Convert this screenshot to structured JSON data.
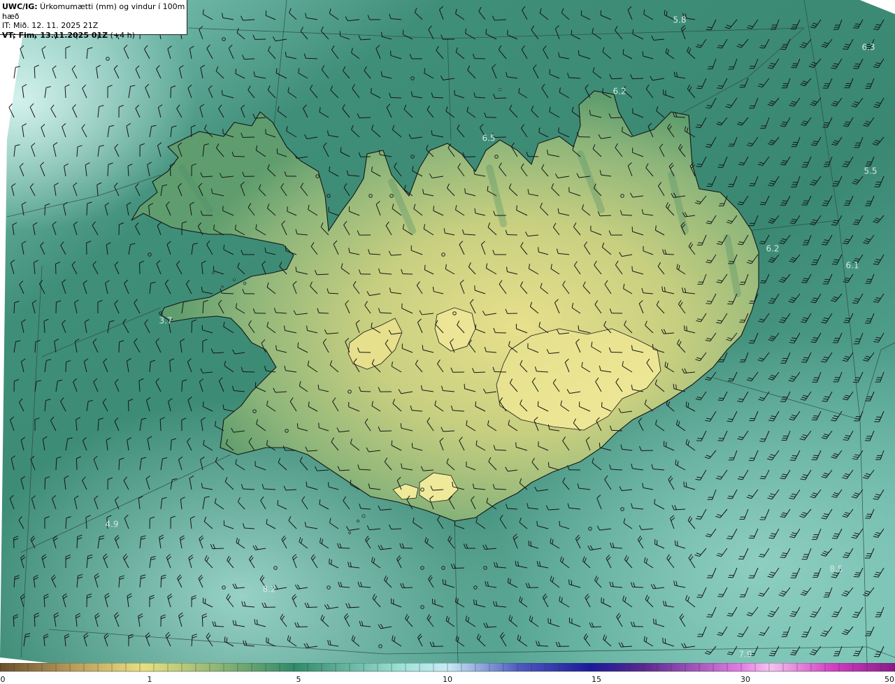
{
  "header": {
    "line1_bold": "UWC/IG:",
    "line1_rest": " Úrkomumætti (mm) og vindur í 100m hæð",
    "line2": "IT: Mið. 12. 11. 2025 21Z",
    "line3_bold": "VT: Fim. 13.11.2025 01Z",
    "line3_rest": " (+4 h)"
  },
  "map": {
    "region": "Iceland",
    "field": "precipitable water",
    "wind_symbol": "wind-barb-icon",
    "sea_color": "#3e8c76",
    "land_low_color": "#5a9a6e",
    "land_high_color": "#e6e08a",
    "coast_color": "#1a1a1a",
    "value_labels": [
      {
        "text": "5.8"
      },
      {
        "text": "6.3"
      },
      {
        "text": "6.2"
      },
      {
        "text": "6.5"
      },
      {
        "text": "5.5"
      },
      {
        "text": "6.2"
      },
      {
        "text": "6.1"
      },
      {
        "text": "3.7"
      },
      {
        "text": "4.9"
      },
      {
        "text": "8.2"
      },
      {
        "text": "8.5"
      },
      {
        "text": "7.9"
      }
    ]
  },
  "legend": {
    "ticks": [
      "0",
      "1",
      "5",
      "10",
      "15",
      "30",
      "50"
    ],
    "colors": [
      "#6b4f2c",
      "#b89a5a",
      "#e9e07f",
      "#2f8a6a",
      "#9fe3d8",
      "#c9ebf6",
      "#4d5ac0",
      "#1a1a9a",
      "#5a2a8f",
      "#e57fe5",
      "#f4c3ee",
      "#d23fc3",
      "#8a1a8a"
    ]
  }
}
